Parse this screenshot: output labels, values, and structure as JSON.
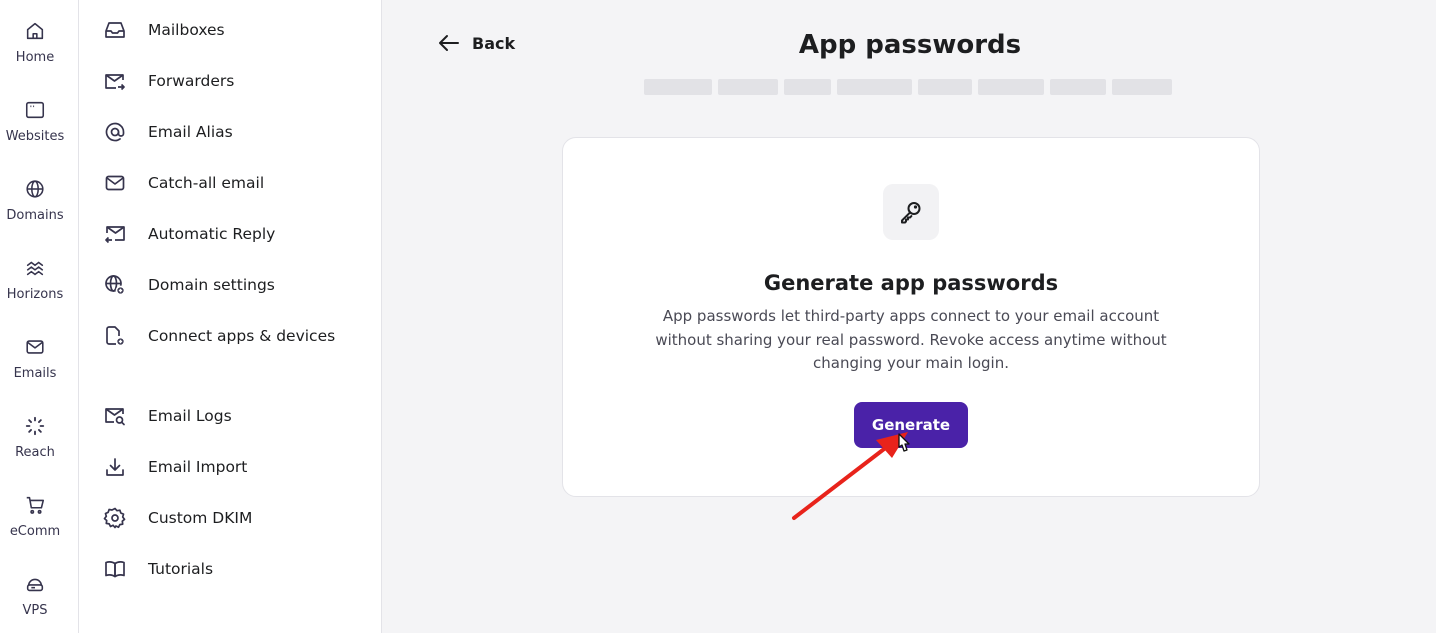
{
  "rail": {
    "items": [
      {
        "label": "Home",
        "icon": "home-icon"
      },
      {
        "label": "Websites",
        "icon": "browser-window-icon"
      },
      {
        "label": "Domains",
        "icon": "globe-icon"
      },
      {
        "label": "Horizons",
        "icon": "horizons-waves-icon"
      },
      {
        "label": "Emails",
        "icon": "mail-icon"
      },
      {
        "label": "Reach",
        "icon": "reach-spinner-icon"
      },
      {
        "label": "eComm",
        "icon": "cart-icon"
      },
      {
        "label": "VPS",
        "icon": "server-cloud-icon"
      }
    ]
  },
  "sidebar": {
    "items": [
      {
        "label": "Mailboxes",
        "icon": "inbox-icon"
      },
      {
        "label": "Forwarders",
        "icon": "mail-forward-icon"
      },
      {
        "label": "Email Alias",
        "icon": "at-sign-icon"
      },
      {
        "label": "Catch-all email",
        "icon": "envelope-icon"
      },
      {
        "label": "Automatic Reply",
        "icon": "mail-reply-icon"
      },
      {
        "label": "Domain settings",
        "icon": "globe-settings-icon"
      },
      {
        "label": "Connect apps & devices",
        "icon": "device-connect-icon"
      },
      {
        "label": "Email Logs",
        "icon": "mail-search-icon"
      },
      {
        "label": "Email Import",
        "icon": "download-icon"
      },
      {
        "label": "Custom DKIM",
        "icon": "gear-icon"
      },
      {
        "label": "Tutorials",
        "icon": "book-icon"
      }
    ]
  },
  "header": {
    "back_label": "Back",
    "title": "App passwords"
  },
  "card": {
    "icon": "key-icon",
    "title": "Generate app passwords",
    "description": "App passwords let third-party apps connect to your email account without sharing your real password. Revoke access anytime without changing your main login.",
    "button_label": "Generate"
  },
  "colors": {
    "accent": "#4a22a8",
    "annotation_arrow": "#e8231b",
    "background": "#f4f4f6"
  }
}
